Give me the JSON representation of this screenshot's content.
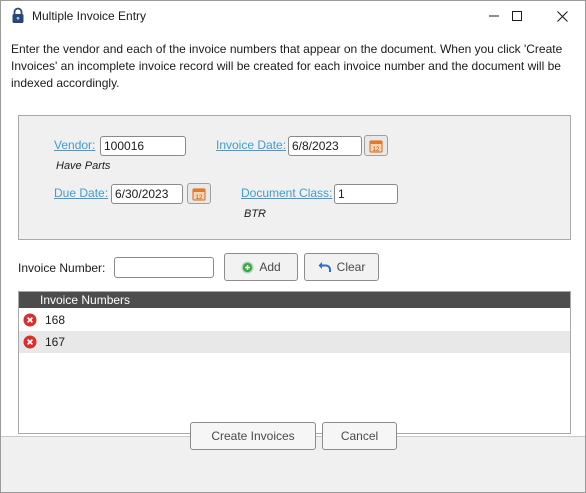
{
  "window": {
    "title": "Multiple Invoice Entry"
  },
  "icons": {
    "title": "lock-icon",
    "minimize": "minimize-icon",
    "maximize": "maximize-icon",
    "close": "close-icon",
    "calendar": "calendar-icon",
    "add": "plus-circle-icon",
    "clear": "undo-arrow-icon",
    "delete": "delete-x-icon"
  },
  "colors": {
    "link": "#3f9cd3",
    "header": "#4d4d4d",
    "alt_row": "#e8e8e8",
    "delete": "#d9302f",
    "add": "#3aa644",
    "clear": "#2c6fd1",
    "calendar": "#e07a2e"
  },
  "intro": "Enter the vendor and each of the invoice numbers that appear on the document. When you click 'Create Invoices' an incomplete invoice record will be created for each invoice number and the document will be indexed accordingly.",
  "form": {
    "vendor_label": "Vendor:",
    "vendor_value": "100016",
    "vendor_name": "Have Parts",
    "invoice_date_label": "Invoice Date:",
    "invoice_date_value": "6/8/2023",
    "due_date_label": "Due Date:",
    "due_date_value": "6/30/2023",
    "doc_class_label": "Document Class:",
    "doc_class_value": "1",
    "doc_class_name": "BTR"
  },
  "entry": {
    "invoice_number_label": "Invoice Number:",
    "invoice_number_value": "",
    "add_label": "Add",
    "clear_label": "Clear"
  },
  "grid": {
    "header": "Invoice Numbers",
    "rows": [
      "168",
      "167"
    ]
  },
  "footer": {
    "create_label": "Create Invoices",
    "cancel_label": "Cancel"
  }
}
